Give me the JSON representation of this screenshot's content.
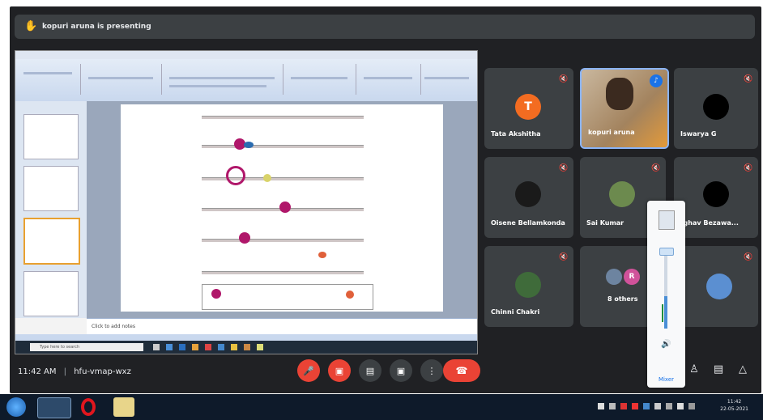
{
  "meet": {
    "presenting_text": "kopuri aruna is presenting",
    "meeting_time": "11:42 AM",
    "separator": "|",
    "meeting_code": "hfu-vmap-wxz"
  },
  "shared_screen": {
    "notes_placeholder": "Click to add notes",
    "search_placeholder": "Type here to search"
  },
  "participants": [
    {
      "name": "Tata Akshitha",
      "initial": "T",
      "avatar_color": "#f36c21"
    },
    {
      "name": "kopuri aruna",
      "is_speaking": true
    },
    {
      "name": "Iswarya G",
      "avatar_color": "#000000"
    },
    {
      "name": "Oisene Bellamkonda"
    },
    {
      "name": "Sai Kumar"
    },
    {
      "name": "Raghav Bezawa..."
    },
    {
      "name": "Chinni Chakri"
    },
    {
      "name": "8 others",
      "avatar_initial": "R",
      "avatar_color": "#d0529a"
    },
    {
      "name": ""
    }
  ],
  "volume_popup": {
    "mixer_label": "Mixer"
  },
  "taskbar": {
    "time": "11:42",
    "date": "22-05-2021"
  },
  "colors": {
    "meet_bg": "#202124",
    "tile_bg": "#3c4043",
    "end_call": "#ea4335",
    "speaking_border": "#8ab4f8"
  },
  "icons": [
    "hand-icon",
    "mic-off-icon",
    "camera-off-icon",
    "captions-icon",
    "present-icon",
    "more-icon",
    "end-call-icon",
    "info-icon",
    "chat-icon",
    "people-icon",
    "speaker-icon",
    "windows-start-icon",
    "opera-icon",
    "chrome-icon",
    "folder-icon"
  ]
}
